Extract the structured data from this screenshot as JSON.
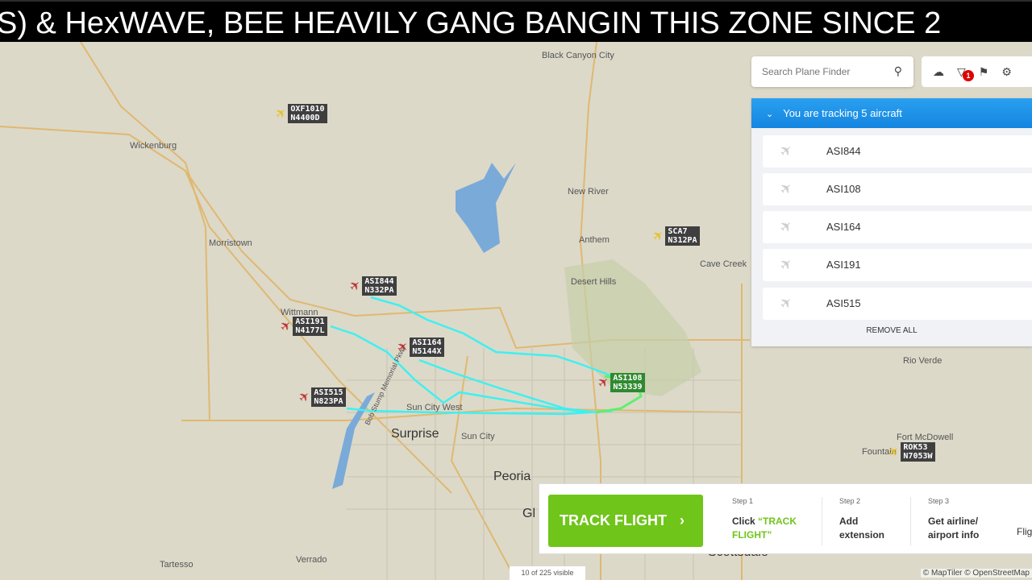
{
  "banner": {
    "text": "S) & HexWAVE, BEE HEAVILY GANG BANGIN THIS ZONE SINCE 2"
  },
  "map": {
    "towns": [
      {
        "name": "Black Canyon City",
        "big": false
      },
      {
        "name": "Wickenburg",
        "big": false
      },
      {
        "name": "New River",
        "big": false
      },
      {
        "name": "Anthem",
        "big": false
      },
      {
        "name": "Cave Creek",
        "big": false
      },
      {
        "name": "Morristown",
        "big": false
      },
      {
        "name": "Desert Hills",
        "big": false
      },
      {
        "name": "Wittmann",
        "big": false
      },
      {
        "name": "Rio Verde",
        "big": false
      },
      {
        "name": "Sun City West",
        "big": false
      },
      {
        "name": "Surprise",
        "big": true
      },
      {
        "name": "Sun City",
        "big": false
      },
      {
        "name": "Peoria",
        "big": true
      },
      {
        "name": "Gl",
        "big": true
      },
      {
        "name": "Fort McDowell",
        "big": false
      },
      {
        "name": "Fountain",
        "big": false
      },
      {
        "name": "Scottsdale",
        "big": true
      },
      {
        "name": "Tartesso",
        "big": false
      },
      {
        "name": "Verrado",
        "big": false
      },
      {
        "name": "Bob Stump Memorial Pkwy",
        "big": false
      }
    ],
    "aircraft": [
      {
        "callsign": "OXF1010",
        "reg": "N4400D",
        "color": "#e8c020",
        "selected": false
      },
      {
        "callsign": "SCA7",
        "reg": "N312PA",
        "color": "#e8c020",
        "selected": false
      },
      {
        "callsign": "ASI844",
        "reg": "N332PA",
        "color": "#c03030",
        "selected": false
      },
      {
        "callsign": "ASI191",
        "reg": "N4177L",
        "color": "#c03030",
        "selected": false
      },
      {
        "callsign": "ASI164",
        "reg": "N5144X",
        "color": "#c03030",
        "selected": false
      },
      {
        "callsign": "ASI515",
        "reg": "N823PA",
        "color": "#c03030",
        "selected": false
      },
      {
        "callsign": "ASI108",
        "reg": "N53339",
        "color": "#c03030",
        "selected": true
      },
      {
        "callsign": "ROK53",
        "reg": "N7053W",
        "color": "#e8c020",
        "selected": false
      }
    ],
    "track_color": "#3ff0f0",
    "visible_count": "10 of 225 visible",
    "attribution": "© MapTiler © OpenStreetMap"
  },
  "search": {
    "placeholder": "Search Plane Finder",
    "icon": "search-icon"
  },
  "toolbar": {
    "icons": [
      "cloud-icon",
      "filter-icon",
      "bookmark-icon",
      "gear-icon"
    ],
    "filter_badge": "1"
  },
  "tracking": {
    "title": "You are tracking 5 aircraft",
    "items": [
      "ASI844",
      "ASI108",
      "ASI164",
      "ASI191",
      "ASI515"
    ],
    "remove_all": "REMOVE ALL",
    "accent": "#1a8fe8"
  },
  "promo": {
    "button": "TRACK FLIGHT",
    "button_color": "#6fc51a",
    "steps": [
      {
        "n": "Step 1",
        "pre": "Click ",
        "hl": "“TRACK FLIGHT”"
      },
      {
        "n": "Step 2",
        "pre": "Add extension",
        "hl": ""
      },
      {
        "n": "Step 3",
        "pre": "Get airline/ airport info",
        "hl": ""
      }
    ],
    "cut": "Flig"
  }
}
